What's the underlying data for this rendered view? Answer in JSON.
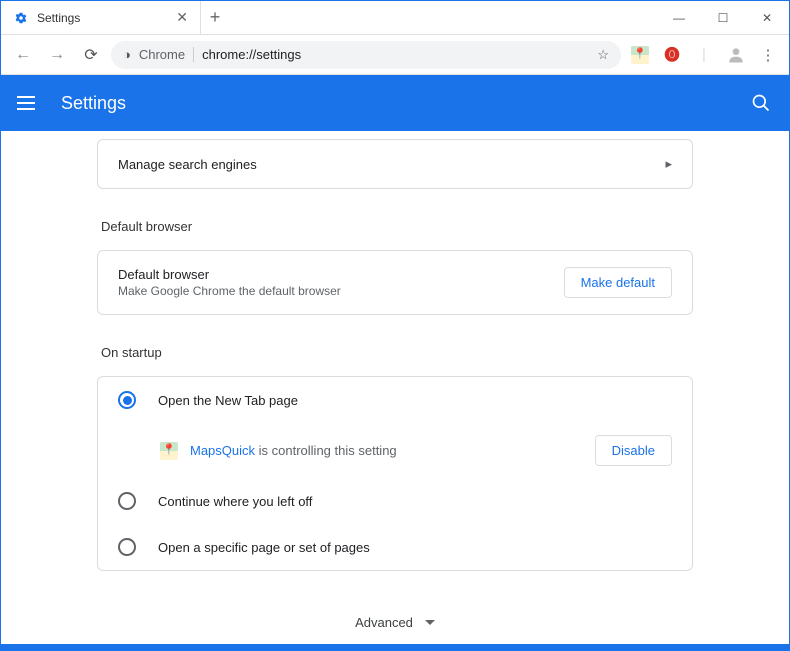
{
  "window": {
    "tab_title": "Settings",
    "min": "—",
    "max": "☐",
    "close": "✕"
  },
  "toolbar": {
    "chrome_label": "Chrome",
    "url": "chrome://settings"
  },
  "header": {
    "title": "Settings"
  },
  "manage_search": {
    "label": "Manage search engines"
  },
  "default_browser": {
    "section": "Default browser",
    "title": "Default browser",
    "subtitle": "Make Google Chrome the default browser",
    "button": "Make default"
  },
  "on_startup": {
    "section": "On startup",
    "options": [
      "Open the New Tab page",
      "Continue where you left off",
      "Open a specific page or set of pages"
    ],
    "extension_name": "MapsQuick",
    "extension_msg": " is controlling this setting",
    "disable": "Disable"
  },
  "advanced": "Advanced"
}
